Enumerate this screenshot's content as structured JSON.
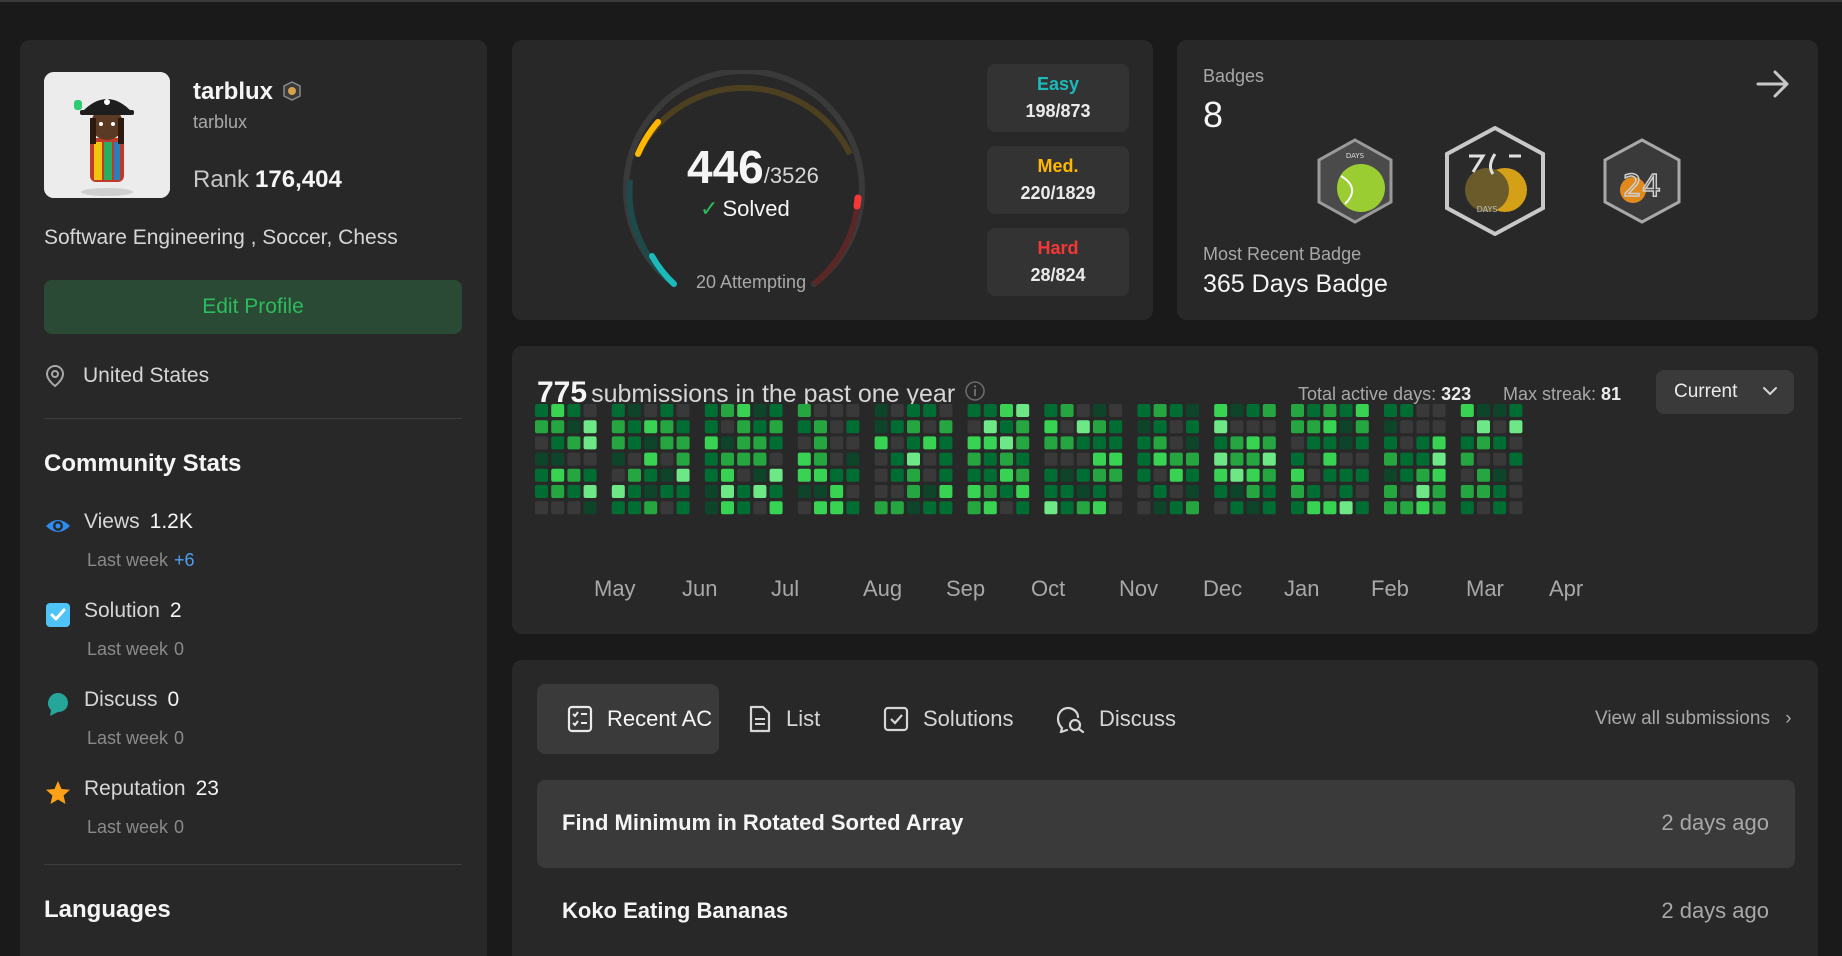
{
  "profile": {
    "username": "tarblux",
    "handle": "tarblux",
    "rank_label": "Rank",
    "rank_value": "176,404",
    "about": "Software Engineering , Soccer, Chess",
    "edit_button": "Edit Profile",
    "location": "United States"
  },
  "community": {
    "title": "Community Stats",
    "views_label": "Views",
    "views_value": "1.2K",
    "views_week_label": "Last week",
    "views_week": "+6",
    "solution_label": "Solution",
    "solution_value": "2",
    "solution_week_label": "Last week",
    "solution_week": "0",
    "discuss_label": "Discuss",
    "discuss_value": "0",
    "discuss_week_label": "Last week",
    "discuss_week": "0",
    "reputation_label": "Reputation",
    "reputation_value": "23",
    "reputation_week_label": "Last week",
    "reputation_week": "0"
  },
  "languages": {
    "title": "Languages"
  },
  "solved": {
    "count": "446",
    "total": "/3526",
    "label": "Solved",
    "attempting": "20 Attempting",
    "easy_label": "Easy",
    "easy_value": "198/873",
    "med_label": "Med.",
    "med_value": "220/1829",
    "hard_label": "Hard",
    "hard_value": "28/824",
    "colors": {
      "easy": "#1cbaba",
      "med": "#ffb700",
      "hard": "#f63737"
    }
  },
  "badges": {
    "title": "Badges",
    "count": "8",
    "recent_label": "Most Recent Badge",
    "recent_name": "365 Days Badge",
    "icons": [
      "days-badge-icon",
      "365-days-badge-icon",
      "2024-badge-icon"
    ]
  },
  "heatmap": {
    "count": "775",
    "title_rest": "submissions in the past one year",
    "active_label": "Total active days:",
    "active_value": "323",
    "streak_label": "Max streak:",
    "streak_value": "81",
    "select_value": "Current",
    "months": [
      "May",
      "Jun",
      "Jul",
      "Aug",
      "Sep",
      "Oct",
      "Nov",
      "Dec",
      "Jan",
      "Feb",
      "Mar",
      "Apr"
    ]
  },
  "submissions": {
    "tabs": [
      "Recent AC",
      "List",
      "Solutions",
      "Discuss"
    ],
    "view_all": "View all submissions",
    "rows": [
      {
        "title": "Find Minimum in Rotated Sorted Array",
        "time": "2 days ago"
      },
      {
        "title": "Koko Eating Bananas",
        "time": "2 days ago"
      }
    ]
  }
}
